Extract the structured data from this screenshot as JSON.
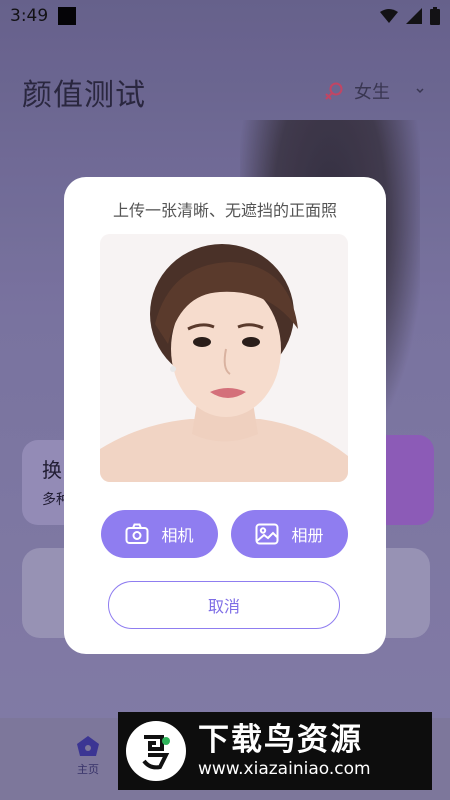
{
  "status_bar": {
    "time": "3:49",
    "icons": [
      "notification-square-icon",
      "wifi-icon",
      "signal-icon",
      "battery-icon"
    ]
  },
  "app": {
    "title": "颜值测试",
    "gender": {
      "icon": "female-symbol-icon",
      "selected": "女生",
      "chevron": "chevron-down-icon"
    },
    "side_card": {
      "title": "换",
      "subtitle": "多种"
    },
    "nav": {
      "home_label": "主页",
      "home_icon": "home-icon"
    }
  },
  "dialog": {
    "title": "上传一张清晰、无遮挡的正面照",
    "camera_label": "相机",
    "album_label": "相册",
    "cancel_label": "取消",
    "camera_icon": "camera-icon",
    "album_icon": "image-icon"
  },
  "watermark": {
    "name": "下载鸟资源",
    "url": "www.xiazainiao.com"
  },
  "colors": {
    "accent": "#8f7df0",
    "cancel_text": "#7e6de6",
    "dialog_bg": "#ffffff"
  }
}
